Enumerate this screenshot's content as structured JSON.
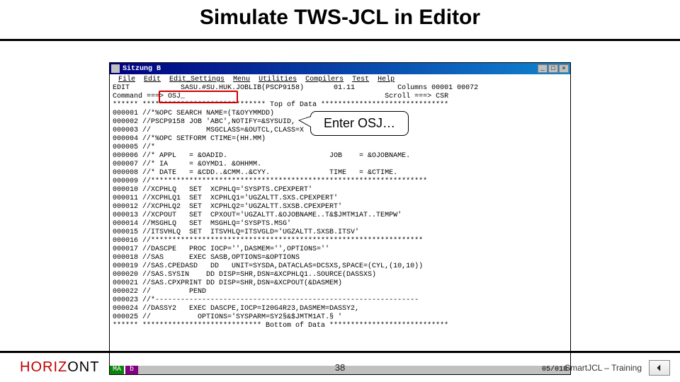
{
  "slide": {
    "title": "Simulate TWS-JCL in Editor",
    "callout": "Enter OSJ…",
    "page_number": "38"
  },
  "footer": {
    "brand_left": "HORIZ",
    "brand_right": "ONT",
    "course": "SmartJCL – Training",
    "nav_icon": "back-arrow"
  },
  "window": {
    "title": "Sitzung B",
    "buttons": {
      "min": "_",
      "max": "□",
      "close": "×"
    }
  },
  "terminal": {
    "menubar": [
      "File",
      "Edit",
      "Edit_Settings",
      "Menu",
      "Utilities",
      "Compilers",
      "Test",
      "Help"
    ],
    "header_left": "EDIT            SASU.#SU.HUK.JOBLIB(PSCP9158)       01.11",
    "header_right": "          Columns 00001 00072",
    "cmd_line_left": "Command ===> OSJ_",
    "cmd_line_right": "Scroll ===> CSR",
    "top_of_data": "****** ***************************** Top of Data ******************************",
    "lines": [
      "000001 //*%OPC SEARCH NAME=(T&OYYMMDD)",
      "000002 //PSCP9158 JOB 'ABC',NOTIFY=&SYSUID,",
      "000003 //             MSGCLASS=&OUTCL,CLASS=X",
      "000004 //*%OPC SETFORM CTIME=(HH.MM)",
      "000005 //*",
      "000006 //* APPL   = &OADID.                        JOB    = &OJOBNAME.",
      "000007 //* IA     = &OYMD1. &OHHMM.",
      "000008 //* DATE   = &CDD..&CMM..&CYY.              TIME   = &CTIME.",
      "000009 //*****************************************************************",
      "000010 //XCPHLQ   SET  XCPHLQ='SYSPTS.CPEXPERT'",
      "000011 //XCPHLQ1  SET  XCPHLQ1='UGZALTT.SXS.CPEXPERT'",
      "000012 //XCPHLQ2  SET  XCPHLQ2='UGZALTT.SXSB.CPEXPERT'",
      "000013 //XCPOUT   SET  CPXOUT='UGZALTT.&OJOBNAME..T&$JMTM1AT..TEMPW'",
      "000014 //MSGHLQ   SET  MSGHLQ='SYSPTS.MSG'",
      "000015 //ITSVHLQ  SET  ITSVHLQ=ITSVGLD='UGZALTT.SXSB.ITSV'",
      "000016 //****************************************************************",
      "000017 //DASCPE   PROC IOCP='',DASMEM='',OPTIONS=''",
      "000018 //SAS      EXEC SASB,OPTIONS=&OPTIONS",
      "000019 //SAS.CPEDASD   DD   UNIT=SYSDA,DATACLAS=DCSXS,SPACE=(CYL,(10,10))",
      "000020 //SAS.SYSIN    DD DISP=SHR,DSN=&XCPHLQ1..SOURCE(DASSXS)",
      "000021 //SAS.CPXPRINT DD DISP=SHR,DSN=&XCPOUT(&DASMEM)",
      "000022 //         PEND",
      "000023 //*--------------------------------------------------------------",
      "000024 //DASSY2   EXEC DASCPE,IOCP=I20G4R23,DASMEM=DASSY2,",
      "000025 //           OPTIONS='SYSPARM=SY2§&$JMTM1AT.§ '"
    ],
    "bottom_of_data": "****** **************************** Bottom of Data ****************************",
    "status": {
      "ma": "MA",
      "b": "b",
      "pos": "05/018"
    }
  }
}
